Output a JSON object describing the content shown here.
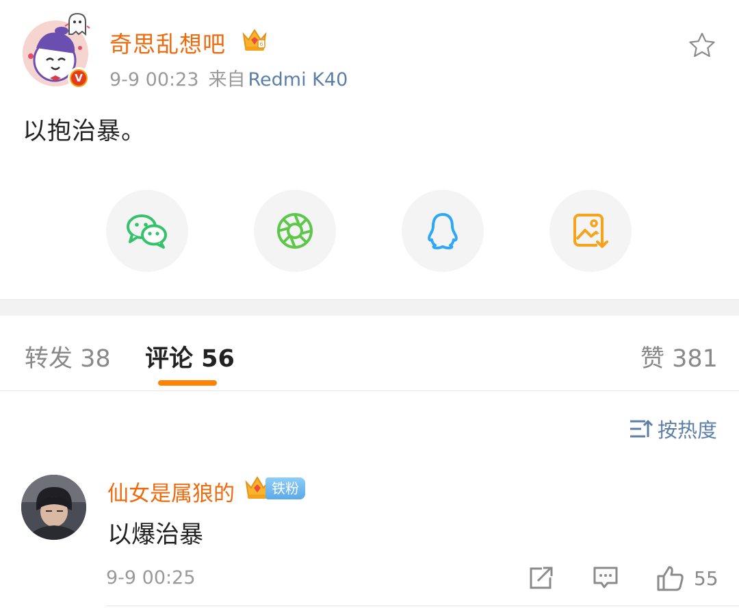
{
  "post": {
    "author_name": "奇思乱想吧",
    "timestamp": "9-9 00:23",
    "source_label": "来自",
    "device": "Redmi K40",
    "text": "以抱治暴。",
    "icons": {
      "avatar": "cartoon-avatar",
      "verified_badge": "verified-v-badge",
      "member_crown": "crown-icon",
      "favorite": "star-icon"
    },
    "verified_badge_text": "V"
  },
  "share": [
    {
      "name": "wechat",
      "icon": "wechat-icon",
      "color": "#34c26b"
    },
    {
      "name": "moments",
      "icon": "moments-icon",
      "color": "#5ec74a"
    },
    {
      "name": "qq",
      "icon": "qq-icon",
      "color": "#2ea8f5"
    },
    {
      "name": "save-image",
      "icon": "save-image-icon",
      "color": "#f8a21a"
    }
  ],
  "tabs": {
    "repost": "转发 38",
    "comments": "评论 56",
    "likes": "赞 381",
    "active": "comments",
    "accent": "#ff8200"
  },
  "sort": {
    "label": "按热度",
    "icon": "sort-icon"
  },
  "comment": {
    "author_name": "仙女是属狼的",
    "fan_badge": "铁粉",
    "text": "以爆治暴",
    "timestamp": "9-9 00:25",
    "like_count": "55",
    "icons": {
      "avatar": "user-photo-avatar",
      "crown": "crown-icon",
      "share": "share-icon",
      "reply": "comment-icon",
      "like": "thumbs-up-icon"
    }
  },
  "colors": {
    "name_orange": "#ee6a0c",
    "link_blue": "#5b7ea8",
    "meta_gray": "#999999"
  }
}
